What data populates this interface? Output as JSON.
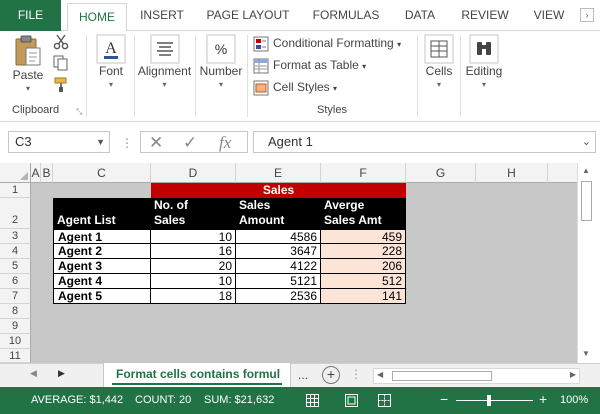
{
  "ribbon_tabs": [
    {
      "label": "FILE"
    },
    {
      "label": "HOME"
    },
    {
      "label": "INSERT"
    },
    {
      "label": "PAGE LAYOUT"
    },
    {
      "label": "FORMULAS"
    },
    {
      "label": "DATA"
    },
    {
      "label": "REVIEW"
    },
    {
      "label": "VIEW"
    }
  ],
  "ribbon": {
    "clipboard": {
      "paste": "Paste",
      "group": "Clipboard"
    },
    "font": "Font",
    "alignment": "Alignment",
    "number": "Number",
    "styles": {
      "conditional": "Conditional Formatting",
      "format_table": "Format as Table",
      "cell_styles": "Cell Styles",
      "group": "Styles"
    },
    "cells": "Cells",
    "editing": "Editing"
  },
  "formula_bar": {
    "name_box": "C3",
    "fx": "fx",
    "content": "Agent 1"
  },
  "columns": [
    "A",
    "B",
    "C",
    "D",
    "E",
    "F",
    "G",
    "H"
  ],
  "rows": [
    "1",
    "2",
    "3",
    "4",
    "5",
    "6",
    "7",
    "8",
    "9",
    "10",
    "11"
  ],
  "table": {
    "banner": "Sales",
    "headers": {
      "agent": "Agent List",
      "num1": "No. of",
      "num2": "Sales",
      "amt1": "Sales",
      "amt2": "Amount",
      "avg1": "Averge",
      "avg2": "Sales Amt"
    },
    "rows": [
      {
        "agent": "Agent 1",
        "num": "10",
        "amount": "4586",
        "avg": "459"
      },
      {
        "agent": "Agent 2",
        "num": "16",
        "amount": "3647",
        "avg": "228"
      },
      {
        "agent": "Agent 3",
        "num": "20",
        "amount": "4122",
        "avg": "206"
      },
      {
        "agent": "Agent 4",
        "num": "10",
        "amount": "5121",
        "avg": "512"
      },
      {
        "agent": "Agent 5",
        "num": "18",
        "amount": "2536",
        "avg": "141"
      }
    ]
  },
  "sheet_tab": "Format cells contains formul",
  "sheet_ellipsis": "...",
  "status": {
    "average": "AVERAGE: $1,442",
    "count": "COUNT: 20",
    "sum": "SUM: $21,632",
    "zoom": "100%"
  },
  "colors": {
    "excel_green": "#217346",
    "banner_red": "#c00000",
    "header_black": "#000000",
    "avg_fill": "#fce4d6",
    "grid_bg": "#c8c8c8"
  }
}
